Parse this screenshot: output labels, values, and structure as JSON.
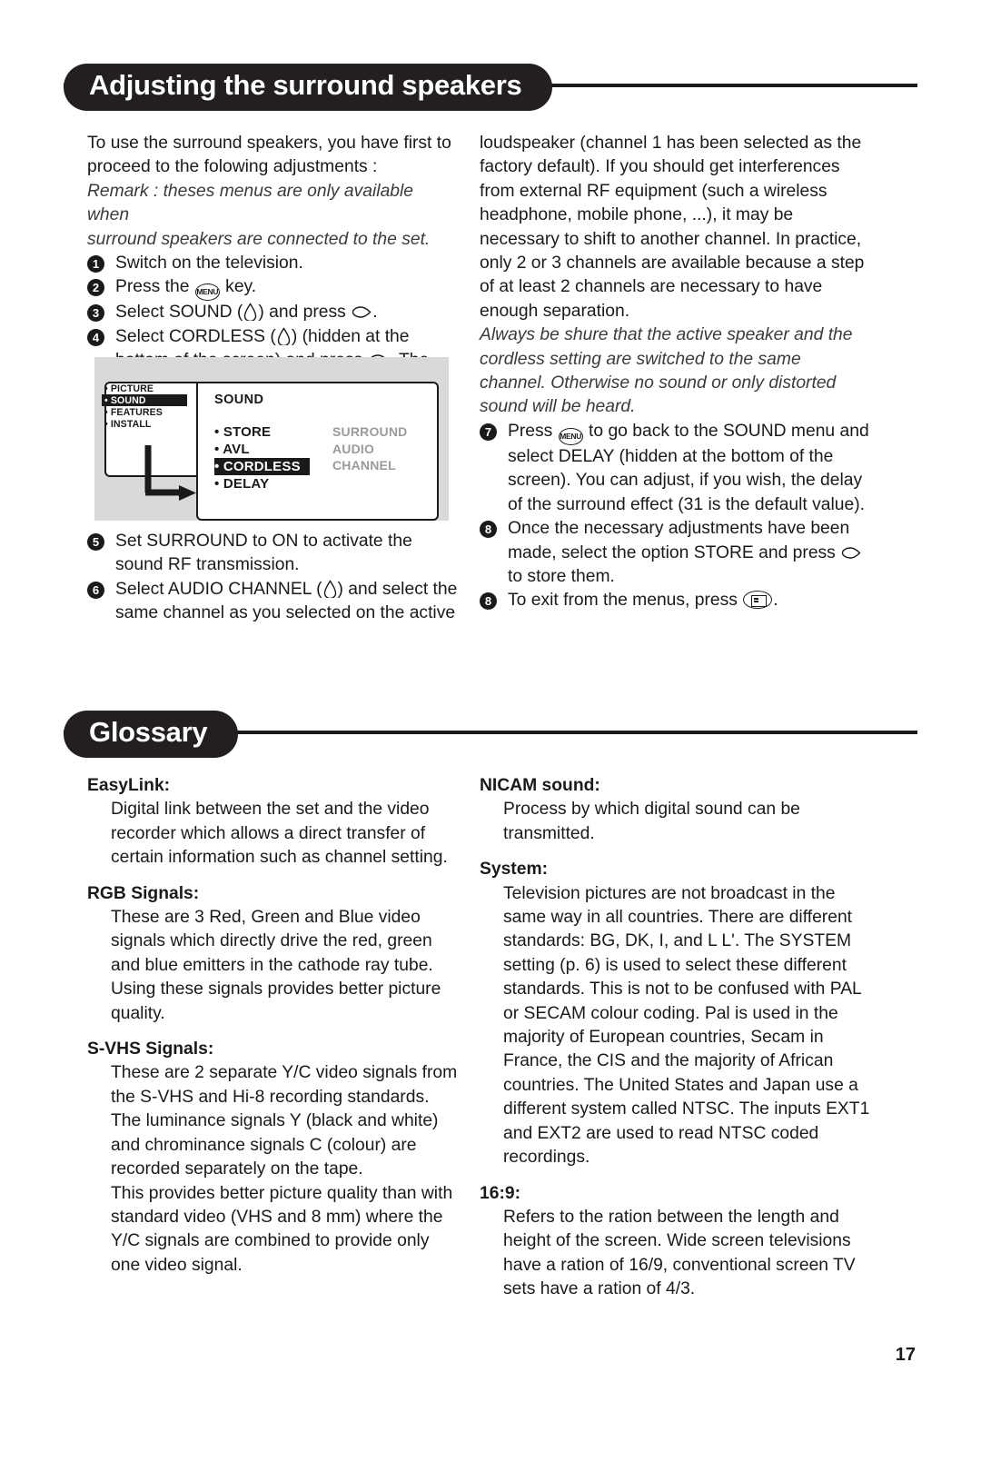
{
  "section1": {
    "title": "Adjusting the surround speakers",
    "left_intro": [
      "To use the surround speakers, you have first to",
      "proceed to the folowing adjustments :"
    ],
    "left_remark": [
      "Remark : theses menus are only available when",
      "surround speakers are connected to the set."
    ],
    "steps_left": [
      {
        "num": "1",
        "text": "Switch on the television."
      },
      {
        "num": "2",
        "pre": "Press the",
        "post": "key.",
        "icon": "menu-key-icon"
      },
      {
        "num": "3",
        "pre": "Select SOUND (",
        "mid": ") and press",
        "post": ".",
        "icon": "cursor-down-icon"
      },
      {
        "num": "4",
        "pre": "Select CORDLESS (",
        "mid": ") (hidden at the bottom of the screen) and press",
        "post": ". The menu appears:",
        "icon": "cursor-down-icon"
      },
      {
        "num": "5",
        "text": "Set SURROUND to ON to activate the sound RF transmission."
      },
      {
        "num": "6",
        "pre": "Select AUDIO CHANNEL (",
        "post": ") and select the same channel as you selected on the active",
        "icon": "cursor-down-icon"
      }
    ],
    "right_continued": "loudspeaker (channel 1 has been selected as the factory default). If you should get interferences from external RF equipment (such a wireless headphone, mobile phone, ...), it may be necessary to shift to another channel. In practice, only 2 or 3 channels are available because a step of at least 2 channels are necessary to have enough separation.",
    "right_remark": "Always be shure that the active speaker and the cordless setting are switched to the same channel. Otherwise no sound or only distorted sound will be heard.",
    "steps_right": [
      {
        "num": "7",
        "pre": "Press",
        "post": "to go back to the SOUND menu and select DELAY (hidden at the bottom of the screen). You can adjust, if you wish, the delay of the surround effect (31 is the default value).",
        "icon": "menu-key-icon"
      },
      {
        "num": "8",
        "pre": "Once the necessary adjustments have been made, select the option STORE and press",
        "post": "to store them.",
        "icon": "cursor-right-icon"
      },
      {
        "num": "8",
        "pre": "To exit from the menus, press",
        "post": ".",
        "icon": "exit-key-icon"
      }
    ],
    "figure": {
      "name": "tv-sound-menu-screenshot",
      "left_menu": [
        "PICTURE",
        "SOUND",
        "FEATURES",
        "INSTALL"
      ],
      "left_menu_selected": "SOUND",
      "panel_title": "SOUND",
      "panel_items": [
        "STORE",
        "AVL",
        "CORDLESS",
        "DELAY"
      ],
      "panel_selected": "CORDLESS",
      "panel_right_labels": [
        "SURROUND",
        "AUDIO CHANNEL"
      ]
    }
  },
  "section2": {
    "title": "Glossary",
    "left_entries": [
      {
        "term": "EasyLink:",
        "def": "Digital link between the set and the video recorder which allows a direct transfer of certain information such as channel setting."
      },
      {
        "term": "RGB Signals:",
        "def": "These are 3 Red, Green and Blue video signals which directly drive the red, green and blue emitters in the cathode ray tube. Using these signals provides better picture quality."
      },
      {
        "term": "S-VHS Signals:",
        "def": "These are 2 separate Y/C video signals from the S-VHS and Hi-8 recording standards.",
        "def2": "The luminance signals Y (black and white) and chrominance signals C (colour) are recorded separately on the tape.",
        "def3": "This provides better picture quality than with standard video (VHS and 8 mm) where the Y/C signals are combined to provide only one video signal."
      }
    ],
    "right_entries": [
      {
        "term": "NICAM sound:",
        "def": "Process by which digital sound can be transmitted."
      },
      {
        "term": "System:",
        "def": "Television pictures are not broadcast in the same way in all countries. There are different standards: BG, DK, I, and L L'. The SYSTEM setting (p. 6) is used to select these different standards. This is not to be confused with PAL or SECAM colour coding. Pal is used in the majority of European countries, Secam in France, the CIS and the majority of African countries. The United States and Japan use a different system called NTSC. The inputs EXT1 and EXT2 are used to read NTSC coded recordings."
      },
      {
        "term": "16:9:",
        "def": "Refers to the ration between the length and height of the screen. Wide screen televisions have a ration of 16/9, conventional screen TV sets have a ration of 4/3."
      }
    ]
  },
  "footer": {
    "page_number": "17"
  },
  "colors": {
    "ink": "#1a1a1a",
    "banner": "#231f20",
    "figure_bg": "#d9d9d9",
    "muted_menu_text": "#9a9a9a"
  }
}
